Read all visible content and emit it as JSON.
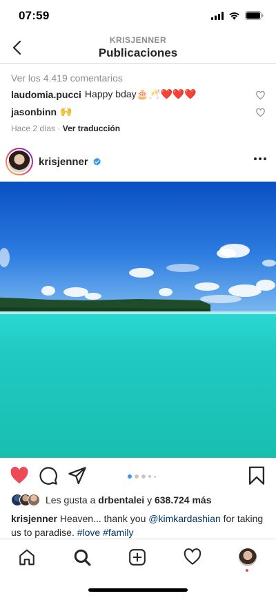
{
  "status": {
    "time": "07:59"
  },
  "header": {
    "account": "KRISJENNER",
    "title": "Publicaciones"
  },
  "comments_section": {
    "view_all": "Ver los 4.419 comentarios",
    "comments": [
      {
        "user": "laudomia.pucci",
        "text": "Happy bday🎂🥂❤️❤️❤️"
      },
      {
        "user": "jasonbinn",
        "text": "🙌"
      }
    ],
    "time_ago": "Hace 2 días",
    "separator": "·",
    "translate": "Ver traducción"
  },
  "post": {
    "username": "krisjenner",
    "verified": true,
    "carousel": {
      "count": 5,
      "active_index": 0
    },
    "likes": {
      "prefix": "Les gusta a",
      "user": "drbentalei",
      "conj": "y",
      "count": "638.724 más"
    },
    "caption": {
      "user": "krisjenner",
      "text_1": "Heaven... thank you",
      "mention": "@kimkardashian",
      "text_2": "for taking us to paradise.",
      "tag_1": "#love",
      "tag_2": "#family"
    }
  },
  "icons": {
    "back": "chevron-left-icon",
    "more": "more-icon",
    "like": "heart-filled-icon",
    "comment": "comment-icon",
    "share": "send-icon",
    "save": "bookmark-icon",
    "home": "home-icon",
    "search": "search-icon",
    "add": "add-icon",
    "activity": "heart-icon",
    "profile": "profile-avatar"
  },
  "colors": {
    "like": "#ed4956",
    "verified": "#3897f0",
    "link": "#00376b",
    "dot_active": "#3897f0"
  }
}
